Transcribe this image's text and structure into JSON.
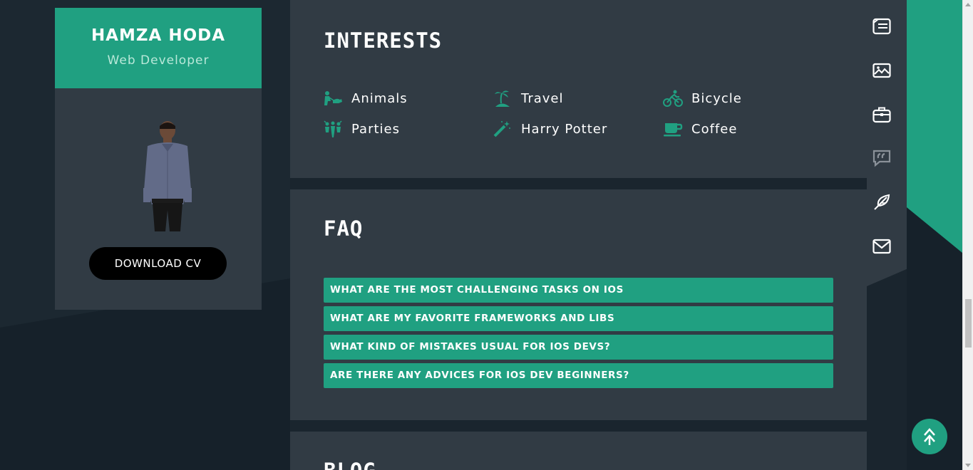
{
  "profile": {
    "name": "HAMZA HODA",
    "role": "Web Developer",
    "download_label": "DOWNLOAD CV"
  },
  "interests": {
    "title": "INTERESTS",
    "items": [
      {
        "label": "Animals",
        "icon": "animals-icon"
      },
      {
        "label": "Travel",
        "icon": "travel-icon"
      },
      {
        "label": "Bicycle",
        "icon": "bicycle-icon"
      },
      {
        "label": "Parties",
        "icon": "parties-icon"
      },
      {
        "label": "Harry Potter",
        "icon": "magic-wand-icon"
      },
      {
        "label": "Coffee",
        "icon": "coffee-icon"
      }
    ]
  },
  "faq": {
    "title": "FAQ",
    "items": [
      "WHAT ARE THE MOST CHALLENGING TASKS ON IOS",
      "WHAT ARE MY FAVORITE FRAMEWORKS AND LIBS",
      "WHAT KIND OF MISTAKES USUAL FOR IOS DEVS?",
      "ARE THERE ANY ADVICES FOR IOS DEV BEGINNERS?"
    ]
  },
  "blog": {
    "title": "BLOG"
  },
  "nav_icons": [
    "resume-icon",
    "portfolio-icon",
    "briefcase-icon",
    "testimonials-icon",
    "blog-feather-icon",
    "mail-icon"
  ],
  "colors": {
    "accent": "#20a081",
    "panel": "#313b44",
    "background": "#1a252e"
  }
}
